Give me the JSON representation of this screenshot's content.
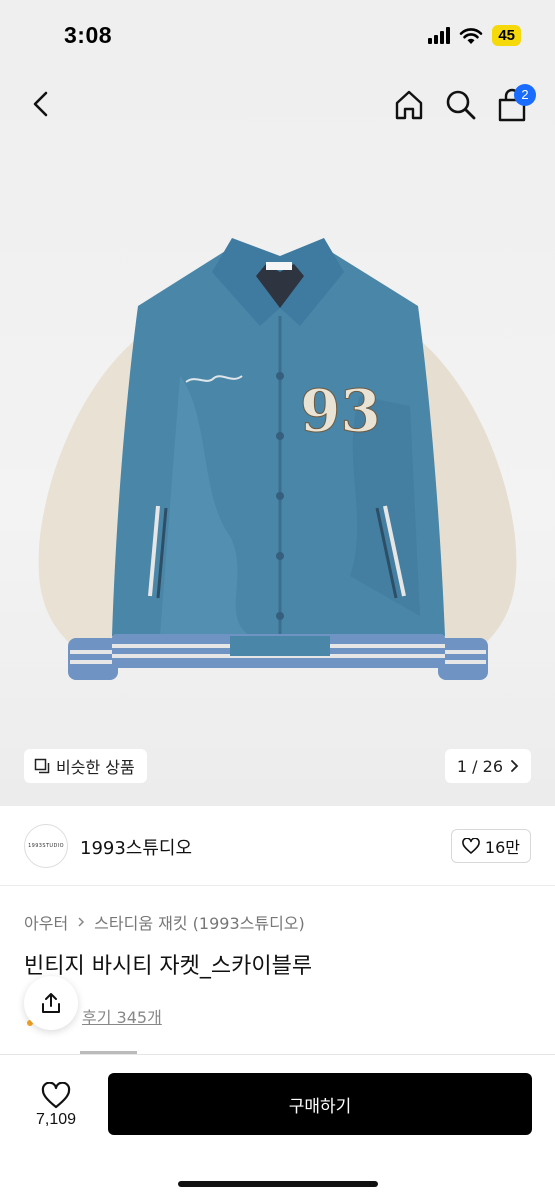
{
  "status": {
    "time": "3:08",
    "battery": "45"
  },
  "nav": {
    "cart_count": "2"
  },
  "hero": {
    "similar_label": "비슷한 상품",
    "page_indicator": "1 / 26",
    "patch_text": "93"
  },
  "shop": {
    "logo_text": "1993STUDIO",
    "name": "1993스튜디오",
    "likes": "16만"
  },
  "product": {
    "breadcrumb": [
      "아우터",
      "스타디움 재킷 (1993스튜디오)"
    ],
    "title": "빈티지 바시티 자켓_스카이블루",
    "reviews": "후기 345개"
  },
  "bottom": {
    "wish_count": "7,109",
    "buy_label": "구매하기"
  },
  "colors": {
    "accent": "#1a6cff",
    "jacket_blue": "#4a86a8",
    "sleeve_cream": "#e8e1d4"
  }
}
